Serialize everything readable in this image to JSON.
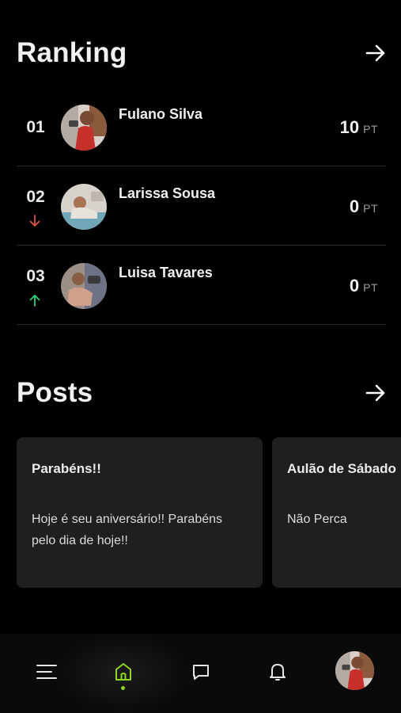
{
  "colors": {
    "background": "#000000",
    "card": "#1f1f1f",
    "trend_down": "#e0524a",
    "trend_up": "#2fd17a",
    "active_nav": "#8fd420"
  },
  "ranking": {
    "title": "Ranking",
    "more_icon": "arrow-right-icon",
    "entries": [
      {
        "position": "01",
        "name": "Fulano Silva",
        "points": "10",
        "unit": "PT",
        "trend": "none"
      },
      {
        "position": "02",
        "name": "Larissa Sousa",
        "points": "0",
        "unit": "PT",
        "trend": "down"
      },
      {
        "position": "03",
        "name": "Luisa Tavares",
        "points": "0",
        "unit": "PT",
        "trend": "up"
      }
    ]
  },
  "posts": {
    "title": "Posts",
    "more_icon": "arrow-right-icon",
    "items": [
      {
        "title": "Parabéns!!",
        "body": "Hoje é seu aniversário!!  Parabéns pelo dia de hoje!!"
      },
      {
        "title": "Aulão de Sábado",
        "body": "Não Perca"
      }
    ]
  },
  "nav": {
    "items": [
      {
        "icon": "menu-icon",
        "active": false
      },
      {
        "icon": "home-icon",
        "active": true
      },
      {
        "icon": "chat-icon",
        "active": false
      },
      {
        "icon": "bell-icon",
        "active": false
      },
      {
        "icon": "profile-avatar",
        "active": false
      }
    ]
  }
}
